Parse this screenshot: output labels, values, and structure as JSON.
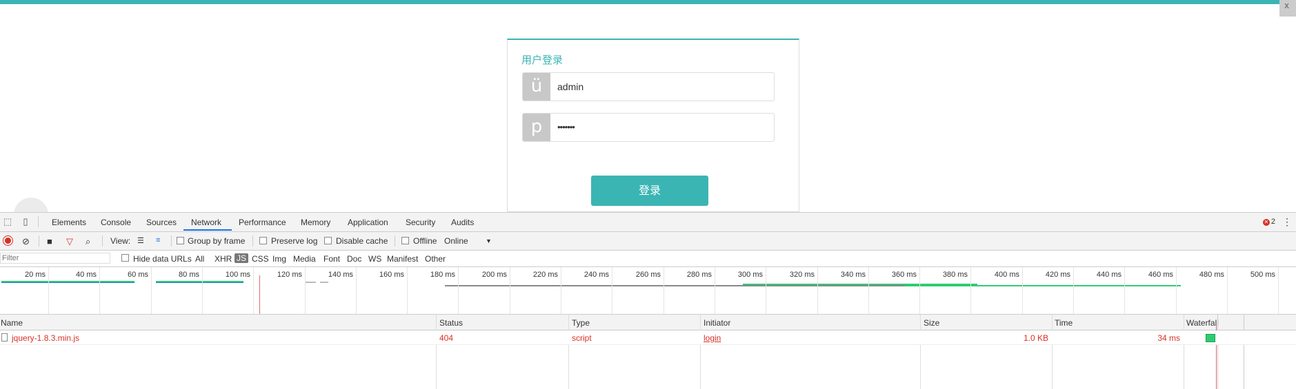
{
  "page": {
    "corner_glyph": "x"
  },
  "login": {
    "title": "用户登录",
    "username_addon": "ü",
    "username_value": "admin",
    "password_addon": "p",
    "password_value": "•••••••",
    "button_label": "登录"
  },
  "devtools": {
    "tabs": [
      "Elements",
      "Console",
      "Sources",
      "Network",
      "Performance",
      "Memory",
      "Application",
      "Security",
      "Audits"
    ],
    "active_tab": "Network",
    "error_count": "2",
    "toolbar": {
      "view_label": "View:",
      "group_by_frame": "Group by frame",
      "preserve_log": "Preserve log",
      "disable_cache": "Disable cache",
      "offline": "Offline",
      "throttle": "Online"
    },
    "filter": {
      "placeholder": "Filter",
      "hide_data_urls": "Hide data URLs",
      "types": [
        "All",
        "XHR",
        "JS",
        "CSS",
        "Img",
        "Media",
        "Font",
        "Doc",
        "WS",
        "Manifest",
        "Other"
      ],
      "selected_type": "JS"
    },
    "timeline_ticks": [
      "20 ms",
      "40 ms",
      "60 ms",
      "80 ms",
      "100 ms",
      "120 ms",
      "140 ms",
      "160 ms",
      "180 ms",
      "200 ms",
      "220 ms",
      "240 ms",
      "260 ms",
      "280 ms",
      "300 ms",
      "320 ms",
      "340 ms",
      "360 ms",
      "380 ms",
      "400 ms",
      "420 ms",
      "440 ms",
      "460 ms",
      "480 ms",
      "500 ms"
    ],
    "columns": [
      "Name",
      "Status",
      "Type",
      "Initiator",
      "Size",
      "Time",
      "Waterfall"
    ],
    "rows": [
      {
        "name": "jquery-1.8.3.min.js",
        "status": "404",
        "type": "script",
        "initiator": "login",
        "size": "1.0 KB",
        "time": "34 ms"
      }
    ],
    "colors": {
      "accent": "#3bb4b4",
      "error": "#d93025",
      "tab_underline": "#1a73e8",
      "waterfall": "#2ecc71"
    }
  }
}
